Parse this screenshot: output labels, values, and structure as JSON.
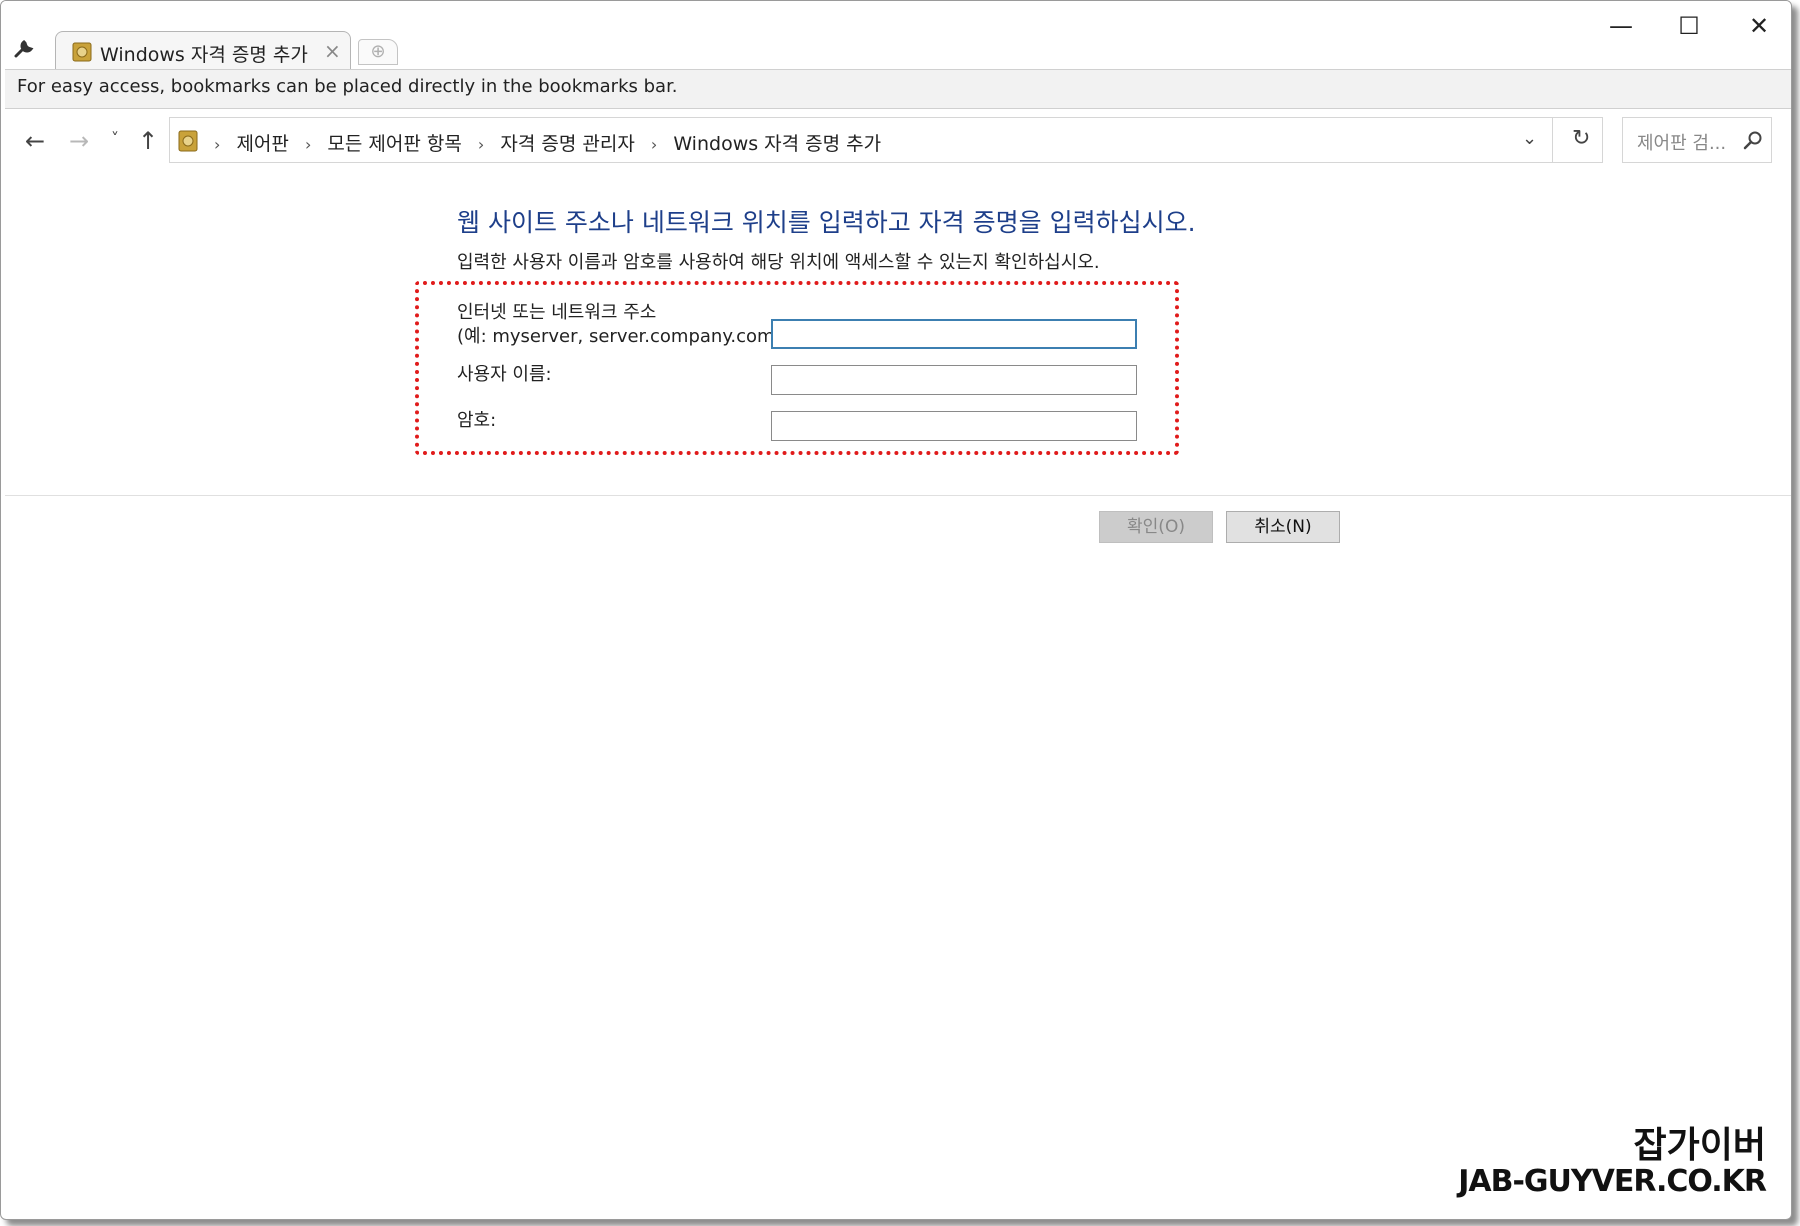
{
  "browser": {
    "tab_title": "Windows 자격 증명 추가",
    "tab_close": "×",
    "new_tab": "⊕",
    "window_controls": {
      "minimize": "—",
      "maximize": "☐",
      "close": "✕"
    },
    "bookmark_bar_text": "For easy access, bookmarks can be placed directly in the bookmarks bar."
  },
  "nav": {
    "back": "←",
    "forward": "→",
    "recent": "˅",
    "up": "↑",
    "breadcrumbs": [
      "제어판",
      "모든 제어판 항목",
      "자격 증명 관리자",
      "Windows 자격 증명 추가"
    ],
    "breadcrumb_separator": "›",
    "dropdown": "⌄",
    "refresh": "↻",
    "search_placeholder": "제어판 검..."
  },
  "main": {
    "heading": "웹 사이트 주소나 네트워크 위치를 입력하고 자격 증명을 입력하십시오.",
    "subtext": "입력한 사용자 이름과 암호를 사용하여 해당 위치에 액세스할 수 있는지 확인하십시오.",
    "fields": [
      {
        "label_line1": "인터넷 또는 네트워크 주소",
        "label_line2": "(예: myserver, server.company.com):",
        "value": ""
      },
      {
        "label_line1": "사용자 이름:",
        "value": ""
      },
      {
        "label_line1": "암호:",
        "value": ""
      }
    ],
    "ok_label": "확인(O)",
    "cancel_label": "취소(N)"
  },
  "watermark": {
    "line1": "잡가이버",
    "line2": "JAB-GUYVER.CO.KR"
  },
  "colors": {
    "heading": "#1e3f8a",
    "highlight_border": "#e01b1b",
    "focused_input": "#3c7fb1"
  }
}
